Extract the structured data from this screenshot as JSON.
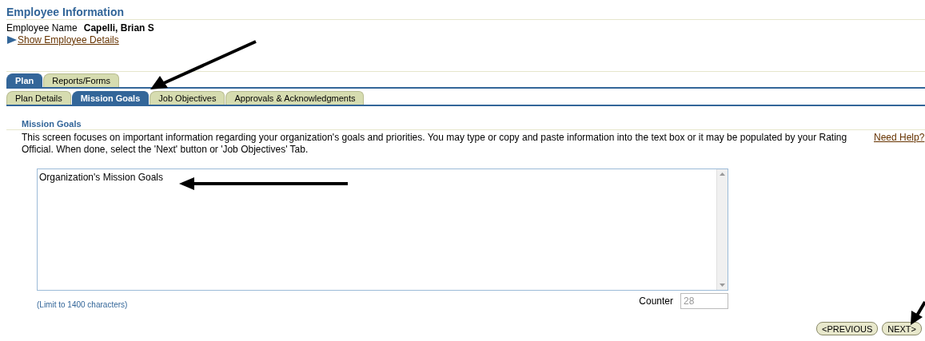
{
  "header": {
    "title": "Employee Information",
    "employee_label": "Employee Name",
    "employee_name": "Capelli, Brian S",
    "details_link": "Show Employee Details"
  },
  "tabs": [
    {
      "label": "Plan",
      "selected": true
    },
    {
      "label": "Reports/Forms",
      "selected": false
    }
  ],
  "subtabs": [
    {
      "label": "Plan Details",
      "selected": false
    },
    {
      "label": "Mission Goals",
      "selected": true
    },
    {
      "label": "Job Objectives",
      "selected": false
    },
    {
      "label": "Approvals & Acknowledgments",
      "selected": false
    }
  ],
  "section": {
    "title": "Mission Goals",
    "description": "This screen focuses on important information regarding your organization's goals and priorities. You may type or copy and paste information into the text box or it may be populated by your Rating Official. When done, select the 'Next' button or 'Job Objectives' Tab.",
    "help_link": "Need Help?"
  },
  "editor": {
    "value": "Organization's Mission Goals",
    "limit_note": "(Limit to 1400 characters)",
    "counter_label": "Counter",
    "counter_value": "28"
  },
  "buttons": [
    "<PREVIOUS",
    "NEXT>"
  ]
}
